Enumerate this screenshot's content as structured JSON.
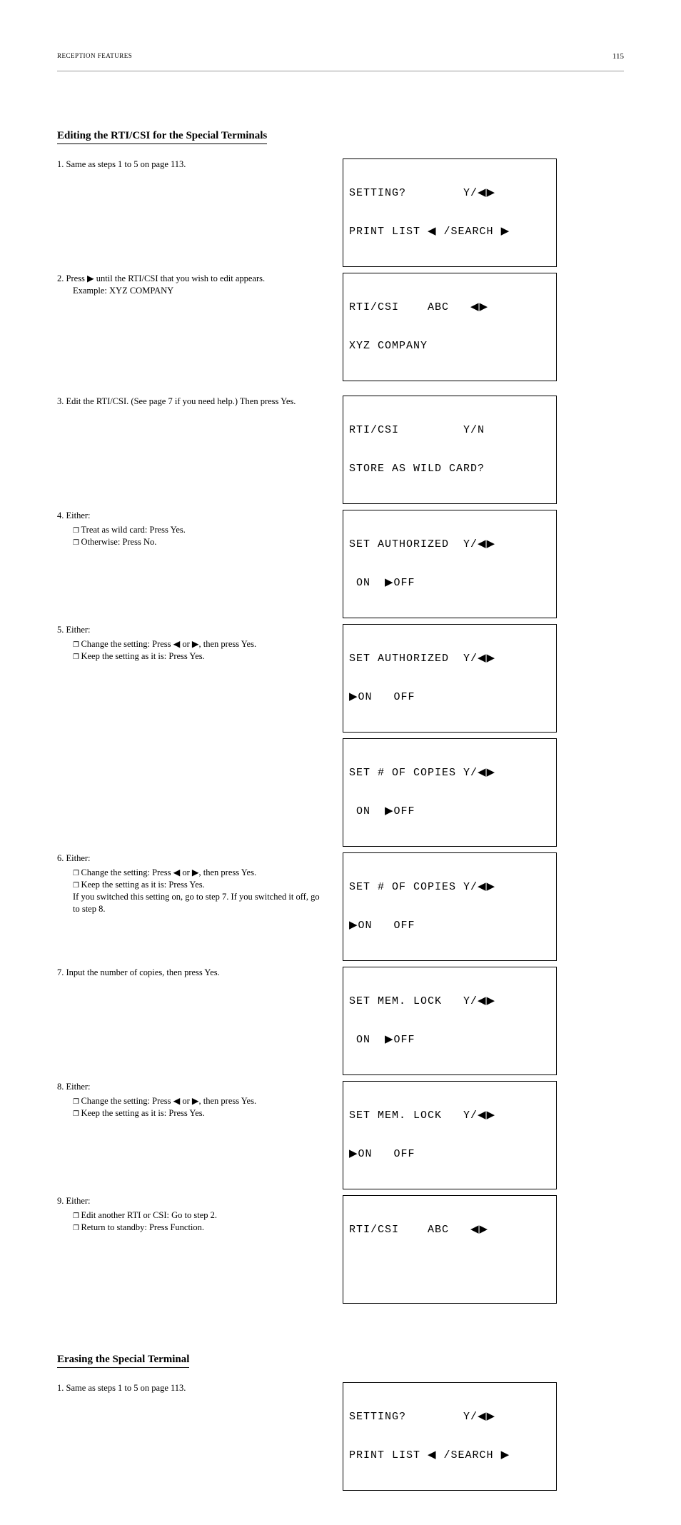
{
  "header": {
    "running": "RECEPTION FEATURES",
    "page": "115"
  },
  "section_edit_title": "Editing the RTI/CSI for the Special Terminals",
  "steps_edit": {
    "s1": {
      "text": "1.   Same as steps 1 to 5 on page 113."
    },
    "s2": {
      "text": "2.   Press ▶ until the RTI/CSI that you wish to edit appears.",
      "note": "Example: XYZ COMPANY"
    },
    "s3": {
      "text": "3.   Edit the RTI/CSI.  (See page 7 if you need help.) Then press Yes."
    },
    "s4": {
      "text": "4.   Either:",
      "opt1": "Treat as wild card: Press Yes.",
      "opt2": "Otherwise: Press No."
    },
    "s5": {
      "text": "5.   Either:",
      "opt1": "Change the setting: Press ◀ or ▶, then press Yes.",
      "opt2": "Keep the setting as it is: Press Yes."
    },
    "s6": {
      "text": "6.   Either:",
      "opt1": "Change the setting: Press ◀ or ▶, then press Yes.",
      "opt2": "Keep the setting as it is: Press Yes.",
      "cont": "If you switched this setting on, go to step 7. If you switched it off,  go to step 8."
    },
    "s7": {
      "text": "7.   Input the number of copies, then press Yes."
    },
    "s8": {
      "text": "8.   Either:",
      "opt1": "Change the setting: Press ◀ or ▶, then press Yes.",
      "opt2": "Keep the setting as it is: Press Yes."
    },
    "s9": {
      "text": "9.   Either:",
      "opt1": "Edit another RTI or CSI: Go to step 2.",
      "opt2": "Return to standby: Press Function."
    }
  },
  "section_erase_title": "Erasing the Special Terminal",
  "steps_erase": {
    "s1": {
      "text": "1.   Same as steps 1 to 5 on page 113."
    }
  },
  "lcd": {
    "setting1": {
      "l1": "SETTING?        Y/◀▶",
      "l2": "PRINT LIST ◀ /SEARCH ▶"
    },
    "rticsi_abc": {
      "l1": "RTI/CSI    ABC   ◀▶",
      "l2": "XYZ COMPANY"
    },
    "wild": {
      "l1": "RTI/CSI         Y/N",
      "l2": "STORE AS WILD CARD?"
    },
    "auth_off": {
      "l1": "SET AUTHORIZED  Y/◀▶",
      "l2": " ON  ▶OFF"
    },
    "auth_on": {
      "l1": "SET AUTHORIZED  Y/◀▶",
      "l2": "▶ON   OFF"
    },
    "copies_off": {
      "l1": "SET # OF COPIES Y/◀▶",
      "l2": " ON  ▶OFF"
    },
    "copies_on": {
      "l1": "SET # OF COPIES Y/◀▶",
      "l2": "▶ON   OFF"
    },
    "mem_off": {
      "l1": "SET MEM. LOCK   Y/◀▶",
      "l2": " ON  ▶OFF"
    },
    "mem_on": {
      "l1": "SET MEM. LOCK   Y/◀▶",
      "l2": "▶ON   OFF"
    },
    "rticsi_blank": {
      "l1": "RTI/CSI    ABC   ◀▶",
      "l2": " "
    },
    "setting2": {
      "l1": "SETTING?        Y/◀▶",
      "l2": "PRINT LIST ◀ /SEARCH ▶"
    }
  }
}
